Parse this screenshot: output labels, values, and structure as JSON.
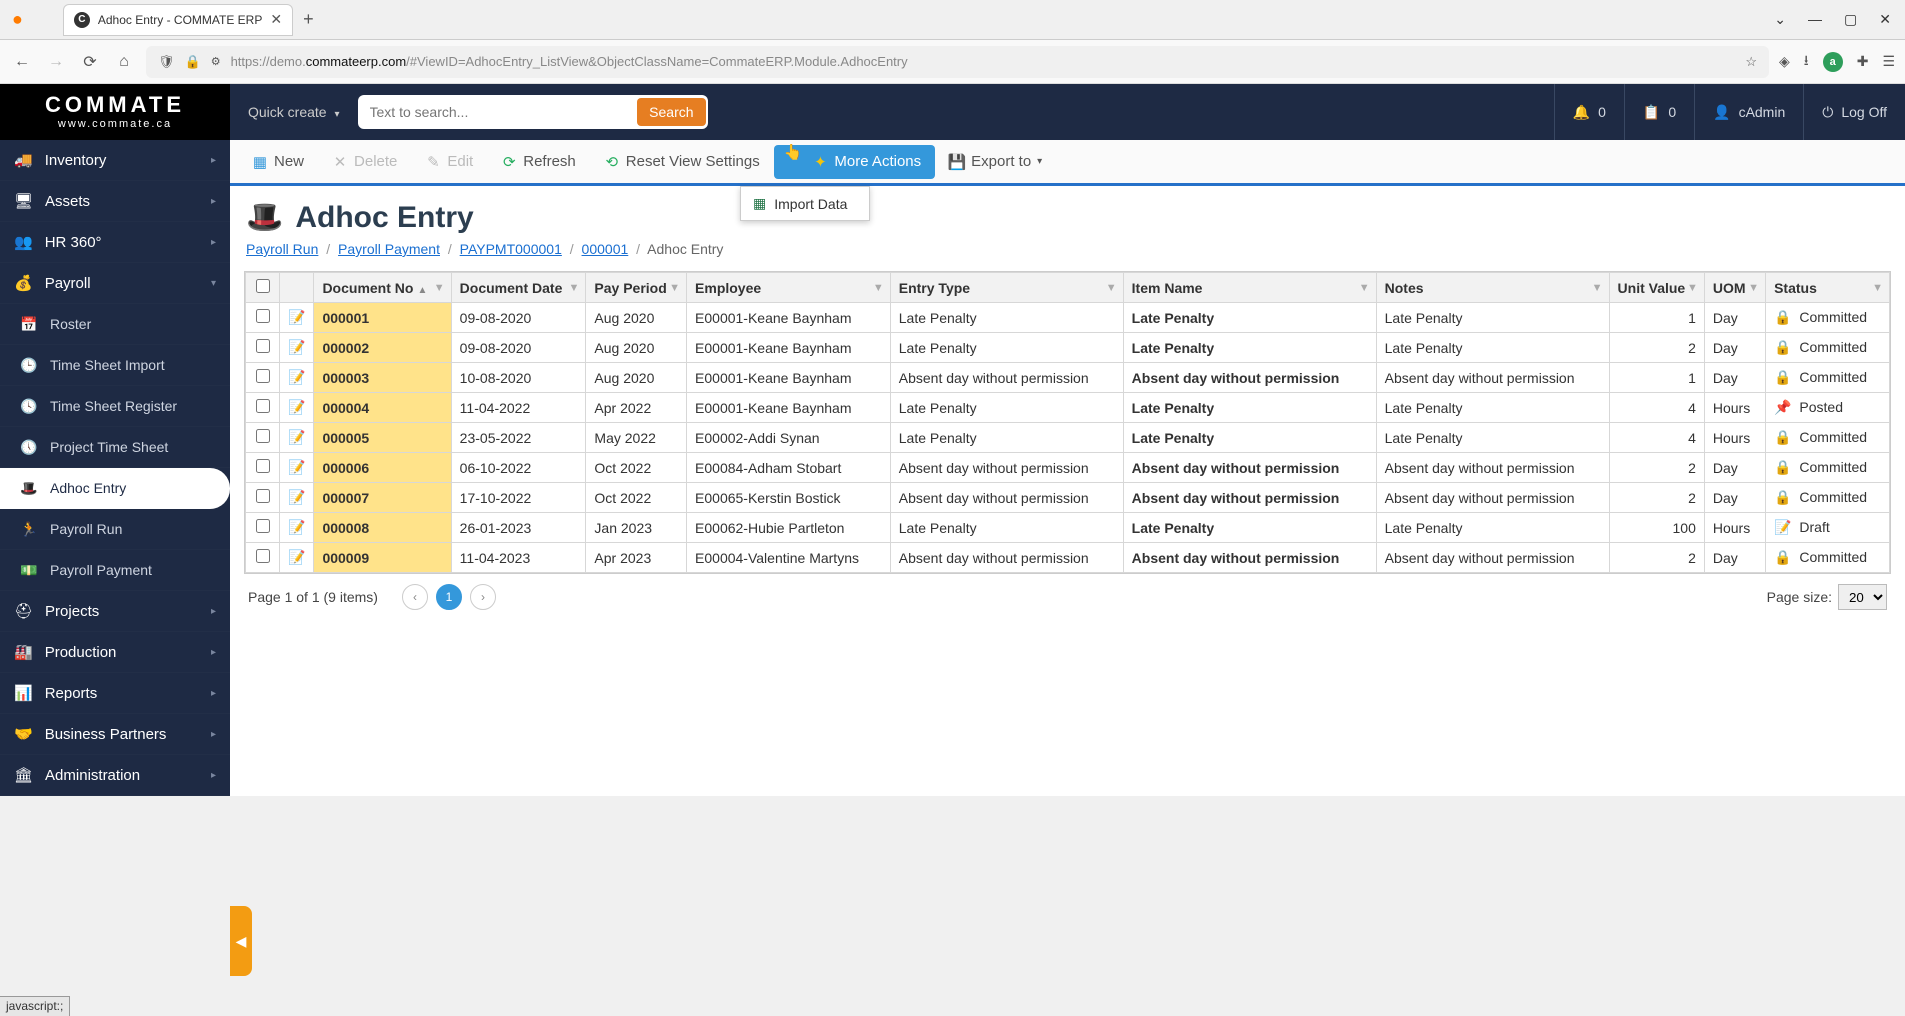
{
  "browser": {
    "tab_title": "Adhoc Entry - COMMATE ERP",
    "url_prefix": "https://demo.",
    "url_domain": "commateerp.com",
    "url_path": "/#ViewID=AdhocEntry_ListView&ObjectClassName=CommateERP.Module.AdhocEntry"
  },
  "logo": {
    "main": "COMMATE",
    "sub": "www.commate.ca"
  },
  "topbar": {
    "quick_create": "Quick create",
    "search_placeholder": "Text to search...",
    "search_button": "Search",
    "notif_count": "0",
    "clip_count": "0",
    "user": "cAdmin",
    "logoff": "Log Off"
  },
  "sidebar": {
    "inventory": "Inventory",
    "assets": "Assets",
    "hr360": "HR 360°",
    "payroll": "Payroll",
    "roster": "Roster",
    "timesheet_import": "Time Sheet Import",
    "timesheet_register": "Time Sheet Register",
    "project_timesheet": "Project Time Sheet",
    "adhoc_entry": "Adhoc Entry",
    "payroll_run": "Payroll Run",
    "payroll_payment": "Payroll Payment",
    "projects": "Projects",
    "production": "Production",
    "reports": "Reports",
    "business_partners": "Business Partners",
    "administration": "Administration"
  },
  "toolbar": {
    "new": "New",
    "delete": "Delete",
    "edit": "Edit",
    "refresh": "Refresh",
    "reset_view": "Reset View Settings",
    "more_actions": "More Actions",
    "export_to": "Export to",
    "import_data": "Import Data"
  },
  "page": {
    "title": "Adhoc Entry",
    "crumbs": {
      "a": "Payroll Run",
      "b": "Payroll Payment",
      "c": "PAYPMT000001",
      "d": "000001",
      "e": "Adhoc Entry"
    }
  },
  "grid": {
    "headers": {
      "doc_no": "Document No",
      "doc_date": "Document Date",
      "pay_period": "Pay Period",
      "employee": "Employee",
      "entry_type": "Entry Type",
      "item_name": "Item Name",
      "notes": "Notes",
      "unit_value": "Unit Value",
      "uom": "UOM",
      "status": "Status"
    },
    "rows": [
      {
        "doc_no": "000001",
        "doc_date": "09-08-2020",
        "pay_period": "Aug 2020",
        "employee": "E00001-Keane Baynham",
        "entry_type": "Late Penalty",
        "item_name": "Late Penalty",
        "notes": "Late Penalty",
        "unit_value": "1",
        "uom": "Day",
        "status": "Committed",
        "status_type": "locked"
      },
      {
        "doc_no": "000002",
        "doc_date": "09-08-2020",
        "pay_period": "Aug 2020",
        "employee": "E00001-Keane Baynham",
        "entry_type": "Late Penalty",
        "item_name": "Late Penalty",
        "notes": "Late Penalty",
        "unit_value": "2",
        "uom": "Day",
        "status": "Committed",
        "status_type": "locked"
      },
      {
        "doc_no": "000003",
        "doc_date": "10-08-2020",
        "pay_period": "Aug 2020",
        "employee": "E00001-Keane Baynham",
        "entry_type": "Absent day without permission",
        "item_name": "Absent day without permission",
        "notes": "Absent day without permission",
        "unit_value": "1",
        "uom": "Day",
        "status": "Committed",
        "status_type": "locked"
      },
      {
        "doc_no": "000004",
        "doc_date": "11-04-2022",
        "pay_period": "Apr 2022",
        "employee": "E00001-Keane Baynham",
        "entry_type": "Late Penalty",
        "item_name": "Late Penalty",
        "notes": "Late Penalty",
        "unit_value": "4",
        "uom": "Hours",
        "status": "Posted",
        "status_type": "posted"
      },
      {
        "doc_no": "000005",
        "doc_date": "23-05-2022",
        "pay_period": "May 2022",
        "employee": "E00002-Addi Synan",
        "entry_type": "Late Penalty",
        "item_name": "Late Penalty",
        "notes": "Late Penalty",
        "unit_value": "4",
        "uom": "Hours",
        "status": "Committed",
        "status_type": "locked"
      },
      {
        "doc_no": "000006",
        "doc_date": "06-10-2022",
        "pay_period": "Oct 2022",
        "employee": "E00084-Adham Stobart",
        "entry_type": "Absent day without permission",
        "item_name": "Absent day without permission",
        "notes": "Absent day without permission",
        "unit_value": "2",
        "uom": "Day",
        "status": "Committed",
        "status_type": "locked"
      },
      {
        "doc_no": "000007",
        "doc_date": "17-10-2022",
        "pay_period": "Oct 2022",
        "employee": "E00065-Kerstin Bostick",
        "entry_type": "Absent day without permission",
        "item_name": "Absent day without permission",
        "notes": "Absent day without permission",
        "unit_value": "2",
        "uom": "Day",
        "status": "Committed",
        "status_type": "locked"
      },
      {
        "doc_no": "000008",
        "doc_date": "26-01-2023",
        "pay_period": "Jan 2023",
        "employee": "E00062-Hubie Partleton",
        "entry_type": "Late Penalty",
        "item_name": "Late Penalty",
        "notes": "Late Penalty",
        "unit_value": "100",
        "uom": "Hours",
        "status": "Draft",
        "status_type": "draft"
      },
      {
        "doc_no": "000009",
        "doc_date": "11-04-2023",
        "pay_period": "Apr 2023",
        "employee": "E00004-Valentine Martyns",
        "entry_type": "Absent day without permission",
        "item_name": "Absent day without permission",
        "notes": "Absent day without permission",
        "unit_value": "2",
        "uom": "Day",
        "status": "Committed",
        "status_type": "locked"
      }
    ]
  },
  "pager": {
    "summary": "Page 1 of 1 (9 items)",
    "current": "1",
    "page_size_label": "Page size:",
    "page_size": "20"
  },
  "statusbar": "javascript:;"
}
